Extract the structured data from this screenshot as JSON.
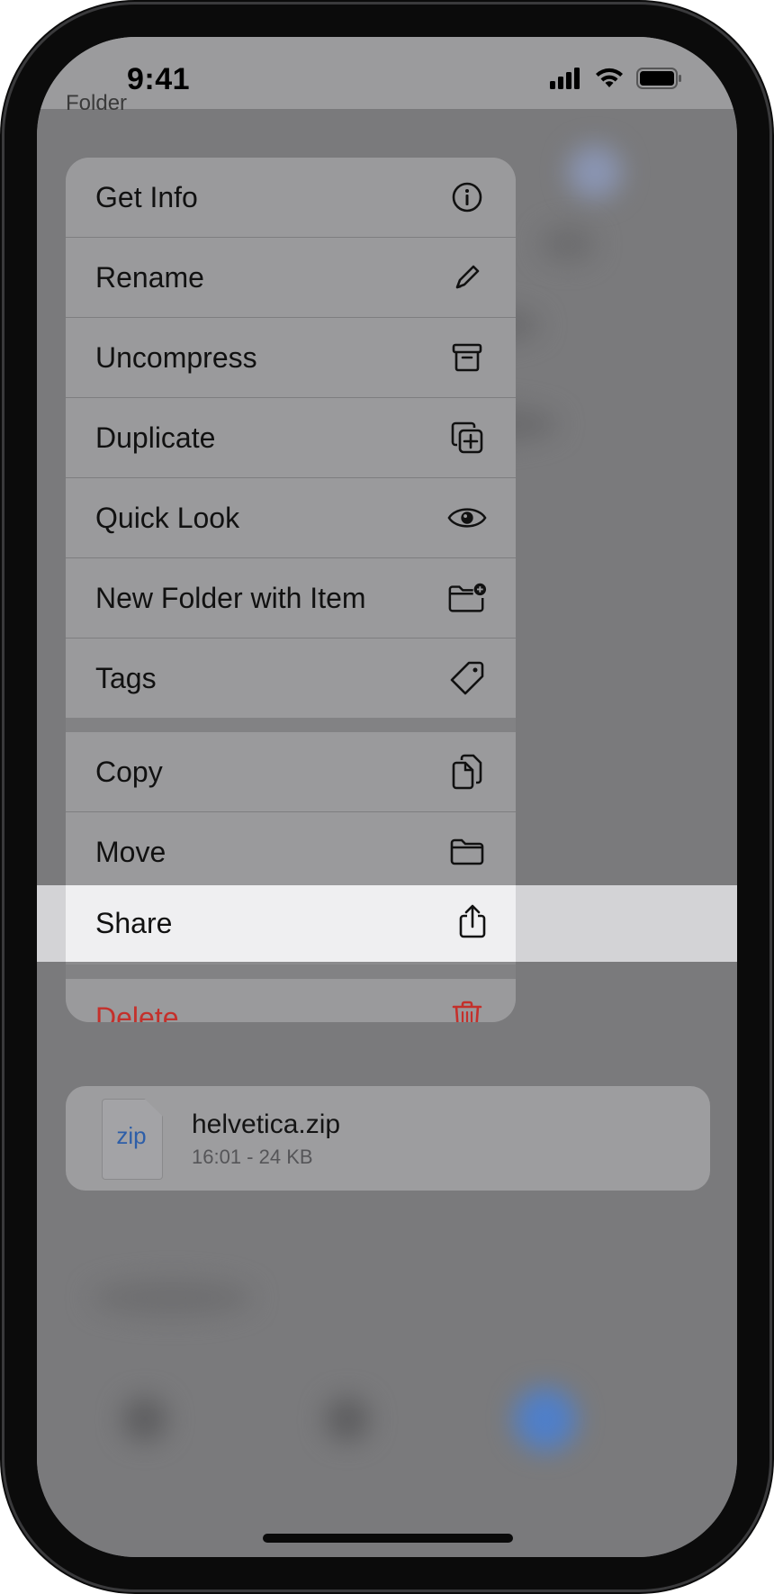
{
  "status_bar": {
    "time": "9:41",
    "back_peek": "Folder"
  },
  "menu": {
    "group1": [
      {
        "label": "Get Info",
        "icon": "info-circle-icon"
      },
      {
        "label": "Rename",
        "icon": "pencil-icon"
      },
      {
        "label": "Uncompress",
        "icon": "archive-box-icon"
      },
      {
        "label": "Duplicate",
        "icon": "duplicate-plus-icon"
      },
      {
        "label": "Quick Look",
        "icon": "eye-icon"
      },
      {
        "label": "New Folder with Item",
        "icon": "folder-plus-icon"
      },
      {
        "label": "Tags",
        "icon": "tag-icon"
      }
    ],
    "group2": [
      {
        "label": "Copy",
        "icon": "copy-docs-icon"
      },
      {
        "label": "Move",
        "icon": "folder-icon"
      },
      {
        "label": "Share",
        "icon": "share-icon",
        "highlighted": true
      }
    ],
    "group3": [
      {
        "label": "Delete",
        "icon": "trash-icon",
        "destructive": true
      }
    ]
  },
  "file": {
    "badge": "zip",
    "name": "helvetica.zip",
    "meta": "16:01 - 24 KB"
  },
  "colors": {
    "destructive": "#c4302b",
    "file_badge": "#2d5ea8",
    "highlight": "#efeff1"
  }
}
